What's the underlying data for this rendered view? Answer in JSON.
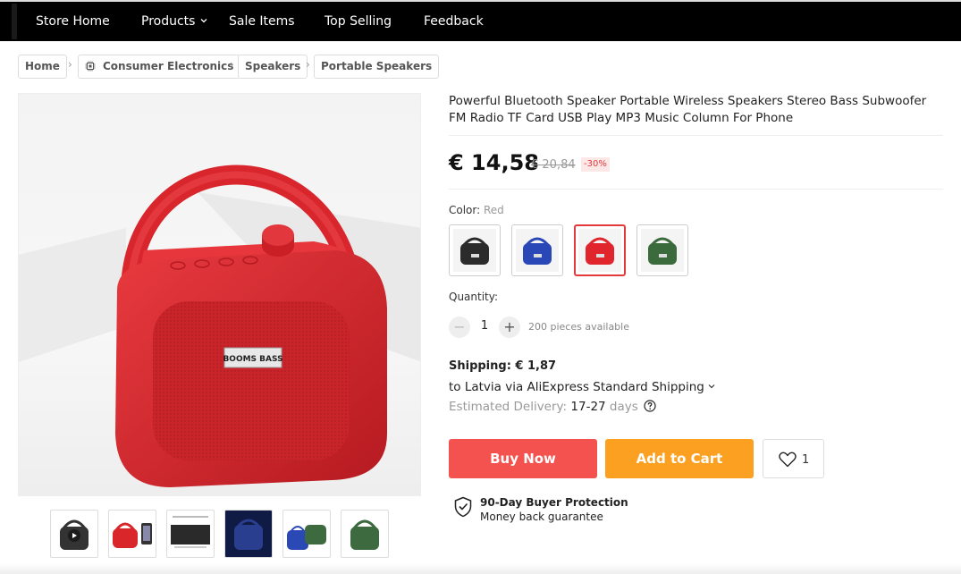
{
  "nav": {
    "items": [
      {
        "label": "Store Home"
      },
      {
        "label": "Products"
      },
      {
        "label": "Sale Items"
      },
      {
        "label": "Top Selling"
      },
      {
        "label": "Feedback"
      }
    ]
  },
  "breadcrumb": {
    "items": [
      {
        "label": "Home"
      },
      {
        "label": "Consumer Electronics",
        "icon": "chip-icon"
      },
      {
        "label": "Speakers"
      },
      {
        "label": "Portable Speakers"
      }
    ],
    "separator": "›"
  },
  "gallery": {
    "brand_plate": "BOOMS BASS",
    "thumbnails": [
      {
        "color": "#333333",
        "icon": "play-icon"
      },
      {
        "color": "#d9262b"
      },
      {
        "color": "#333333"
      },
      {
        "color": "#2a3e8f"
      },
      {
        "color": "#2b49b5"
      },
      {
        "color": "#3d6b3f"
      }
    ]
  },
  "product": {
    "title": "Powerful Bluetooth Speaker Portable Wireless Speakers Stereo Bass Subwoofer FM Radio TF Card USB Play MP3 Music Column For Phone",
    "price": "€ 14,58",
    "old_price": "€ 20,84",
    "discount": "-30%",
    "color_label": "Color:",
    "color_value": "Red",
    "colors": [
      {
        "name": "Black",
        "hex": "#2b2b2b"
      },
      {
        "name": "Blue",
        "hex": "#2a47b8"
      },
      {
        "name": "Red",
        "hex": "#e0252d",
        "selected": true
      },
      {
        "name": "Green",
        "hex": "#3b6a3c"
      }
    ],
    "quantity_label": "Quantity:",
    "quantity": "1",
    "minus": "−",
    "plus": "+",
    "available": "200 pieces available",
    "shipping": "Shipping: € 1,87",
    "ship_to": "to Latvia via AliExpress Standard Shipping",
    "delivery_label": "Estimated Delivery:",
    "delivery_range": "17-27",
    "delivery_unit": "days",
    "buy_now": "Buy Now",
    "add_to_cart": "Add to Cart",
    "wishlist_count": "1",
    "protection_title": "90-Day Buyer Protection",
    "protection_sub": "Money back guarantee"
  },
  "colors": {
    "accent_red": "#f3524f",
    "accent_orange": "#fca021",
    "nav_bg": "#000000"
  }
}
